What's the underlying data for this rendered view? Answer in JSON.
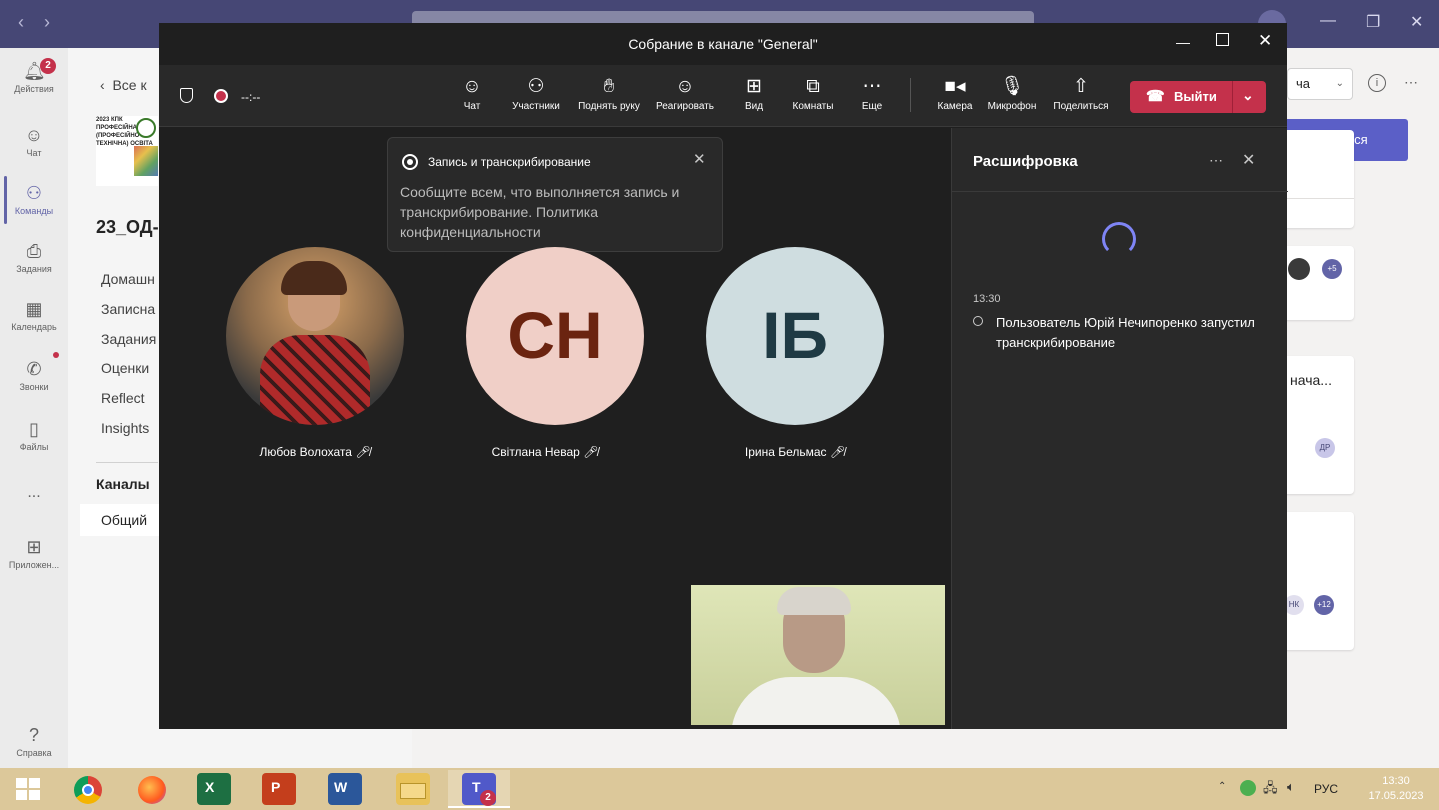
{
  "teams": {
    "rail": [
      {
        "label": "Действия",
        "icon": "bell-icon",
        "badge": "2"
      },
      {
        "label": "Чат",
        "icon": "chat-icon"
      },
      {
        "label": "Команды",
        "icon": "teams-icon"
      },
      {
        "label": "Задания",
        "icon": "assignments-icon"
      },
      {
        "label": "Календарь",
        "icon": "calendar-icon"
      },
      {
        "label": "Звонки",
        "icon": "phone-icon"
      },
      {
        "label": "Файлы",
        "icon": "file-icon"
      },
      {
        "label": "...",
        "icon": "more-icon"
      },
      {
        "label": "Приложен...",
        "icon": "apps-icon"
      },
      {
        "label": "Справка",
        "icon": "help-icon"
      }
    ],
    "left_pane": {
      "back_label": "Все к",
      "logo_text": "2023 КПК ПРОФЕСІЙНА (ПРОФЕСІЙНО ТЕХНІЧНА) ОСВІТА",
      "team_name": "23_ОД-",
      "items": [
        "Домашн",
        "Записна",
        "Задания",
        "Оценки",
        "Reflect",
        "Insights"
      ],
      "channels_header": "Каналы",
      "channel": "Общий"
    },
    "main_pane": {
      "dropdown_text": "ча",
      "join_label": "исоединиться",
      "card_text_1": "нача...",
      "avatar_more_1": "+5",
      "avatar_dr": "ДР",
      "avatar_nk": "НК",
      "avatar_more_2": "+12"
    }
  },
  "meeting": {
    "title": "Собрание в канале \"General\"",
    "timer": "--:--",
    "toolbar": [
      {
        "label": "Чат",
        "icon": "chat-icon"
      },
      {
        "label": "Участники",
        "icon": "participants-icon"
      },
      {
        "label": "Поднять руку",
        "icon": "raise-hand-icon"
      },
      {
        "label": "Реагировать",
        "icon": "emoji-icon"
      },
      {
        "label": "Вид",
        "icon": "view-icon"
      },
      {
        "label": "Комнаты",
        "icon": "rooms-icon"
      },
      {
        "label": "Еще",
        "icon": "more-icon"
      },
      {
        "label": "Камера",
        "icon": "camera-icon"
      },
      {
        "label": "Микрофон",
        "icon": "mic-icon"
      },
      {
        "label": "Поделиться",
        "icon": "share-icon"
      }
    ],
    "leave_label": "Выйти",
    "tip": {
      "title": "Запись и транскрибирование",
      "body": "Сообщите всем, что выполняется запись и транскрибирование. Политика конфиденциальности"
    },
    "participants": [
      {
        "name": "Любов Волохата",
        "initials": "",
        "bg": "#8a6a4a",
        "muted": true
      },
      {
        "name": "Світлана Невар",
        "initials": "СН",
        "bg": "#f0cfc7",
        "fg": "#6b2410",
        "muted": true
      },
      {
        "name": "Ірина Бельмас",
        "initials": "ІБ",
        "bg": "#cfdde0",
        "fg": "#1f3a44",
        "muted": true
      }
    ],
    "transcript": {
      "title": "Расшифровка",
      "time": "13:30",
      "message": "Пользователь Юрій Нечипоренко запустил транскрибирование"
    }
  },
  "taskbar": {
    "lang": "РУС",
    "time": "13:30",
    "date": "17.05.2023",
    "teams_badge": "2"
  },
  "colors": {
    "accent": "#6264a7",
    "leave": "#c4314b",
    "meeting_bg": "#1f1f1f"
  }
}
